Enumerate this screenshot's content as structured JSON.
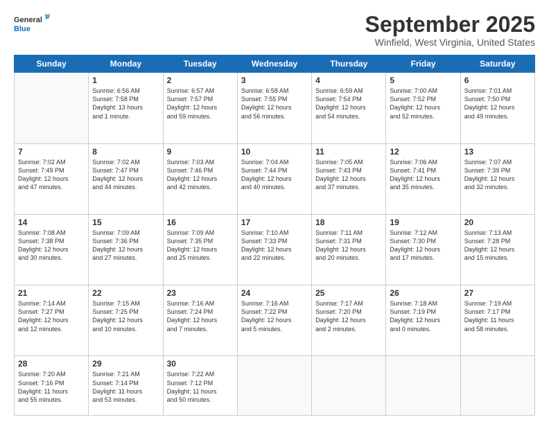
{
  "logo": {
    "line1": "General",
    "line2": "Blue"
  },
  "title": "September 2025",
  "location": "Winfield, West Virginia, United States",
  "days_of_week": [
    "Sunday",
    "Monday",
    "Tuesday",
    "Wednesday",
    "Thursday",
    "Friday",
    "Saturday"
  ],
  "weeks": [
    [
      {
        "day": "",
        "info": ""
      },
      {
        "day": "1",
        "info": "Sunrise: 6:56 AM\nSunset: 7:58 PM\nDaylight: 13 hours\nand 1 minute."
      },
      {
        "day": "2",
        "info": "Sunrise: 6:57 AM\nSunset: 7:57 PM\nDaylight: 12 hours\nand 59 minutes."
      },
      {
        "day": "3",
        "info": "Sunrise: 6:58 AM\nSunset: 7:55 PM\nDaylight: 12 hours\nand 56 minutes."
      },
      {
        "day": "4",
        "info": "Sunrise: 6:59 AM\nSunset: 7:54 PM\nDaylight: 12 hours\nand 54 minutes."
      },
      {
        "day": "5",
        "info": "Sunrise: 7:00 AM\nSunset: 7:52 PM\nDaylight: 12 hours\nand 52 minutes."
      },
      {
        "day": "6",
        "info": "Sunrise: 7:01 AM\nSunset: 7:50 PM\nDaylight: 12 hours\nand 49 minutes."
      }
    ],
    [
      {
        "day": "7",
        "info": "Sunrise: 7:02 AM\nSunset: 7:49 PM\nDaylight: 12 hours\nand 47 minutes."
      },
      {
        "day": "8",
        "info": "Sunrise: 7:02 AM\nSunset: 7:47 PM\nDaylight: 12 hours\nand 44 minutes."
      },
      {
        "day": "9",
        "info": "Sunrise: 7:03 AM\nSunset: 7:46 PM\nDaylight: 12 hours\nand 42 minutes."
      },
      {
        "day": "10",
        "info": "Sunrise: 7:04 AM\nSunset: 7:44 PM\nDaylight: 12 hours\nand 40 minutes."
      },
      {
        "day": "11",
        "info": "Sunrise: 7:05 AM\nSunset: 7:43 PM\nDaylight: 12 hours\nand 37 minutes."
      },
      {
        "day": "12",
        "info": "Sunrise: 7:06 AM\nSunset: 7:41 PM\nDaylight: 12 hours\nand 35 minutes."
      },
      {
        "day": "13",
        "info": "Sunrise: 7:07 AM\nSunset: 7:39 PM\nDaylight: 12 hours\nand 32 minutes."
      }
    ],
    [
      {
        "day": "14",
        "info": "Sunrise: 7:08 AM\nSunset: 7:38 PM\nDaylight: 12 hours\nand 30 minutes."
      },
      {
        "day": "15",
        "info": "Sunrise: 7:09 AM\nSunset: 7:36 PM\nDaylight: 12 hours\nand 27 minutes."
      },
      {
        "day": "16",
        "info": "Sunrise: 7:09 AM\nSunset: 7:35 PM\nDaylight: 12 hours\nand 25 minutes."
      },
      {
        "day": "17",
        "info": "Sunrise: 7:10 AM\nSunset: 7:33 PM\nDaylight: 12 hours\nand 22 minutes."
      },
      {
        "day": "18",
        "info": "Sunrise: 7:11 AM\nSunset: 7:31 PM\nDaylight: 12 hours\nand 20 minutes."
      },
      {
        "day": "19",
        "info": "Sunrise: 7:12 AM\nSunset: 7:30 PM\nDaylight: 12 hours\nand 17 minutes."
      },
      {
        "day": "20",
        "info": "Sunrise: 7:13 AM\nSunset: 7:28 PM\nDaylight: 12 hours\nand 15 minutes."
      }
    ],
    [
      {
        "day": "21",
        "info": "Sunrise: 7:14 AM\nSunset: 7:27 PM\nDaylight: 12 hours\nand 12 minutes."
      },
      {
        "day": "22",
        "info": "Sunrise: 7:15 AM\nSunset: 7:25 PM\nDaylight: 12 hours\nand 10 minutes."
      },
      {
        "day": "23",
        "info": "Sunrise: 7:16 AM\nSunset: 7:24 PM\nDaylight: 12 hours\nand 7 minutes."
      },
      {
        "day": "24",
        "info": "Sunrise: 7:16 AM\nSunset: 7:22 PM\nDaylight: 12 hours\nand 5 minutes."
      },
      {
        "day": "25",
        "info": "Sunrise: 7:17 AM\nSunset: 7:20 PM\nDaylight: 12 hours\nand 2 minutes."
      },
      {
        "day": "26",
        "info": "Sunrise: 7:18 AM\nSunset: 7:19 PM\nDaylight: 12 hours\nand 0 minutes."
      },
      {
        "day": "27",
        "info": "Sunrise: 7:19 AM\nSunset: 7:17 PM\nDaylight: 11 hours\nand 58 minutes."
      }
    ],
    [
      {
        "day": "28",
        "info": "Sunrise: 7:20 AM\nSunset: 7:16 PM\nDaylight: 11 hours\nand 55 minutes."
      },
      {
        "day": "29",
        "info": "Sunrise: 7:21 AM\nSunset: 7:14 PM\nDaylight: 11 hours\nand 53 minutes."
      },
      {
        "day": "30",
        "info": "Sunrise: 7:22 AM\nSunset: 7:12 PM\nDaylight: 11 hours\nand 50 minutes."
      },
      {
        "day": "",
        "info": ""
      },
      {
        "day": "",
        "info": ""
      },
      {
        "day": "",
        "info": ""
      },
      {
        "day": "",
        "info": ""
      }
    ]
  ]
}
